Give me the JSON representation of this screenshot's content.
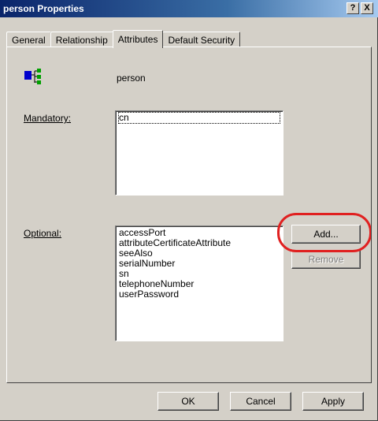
{
  "window": {
    "title": "person Properties",
    "help_button": "?",
    "close_button": "X"
  },
  "tabs": [
    {
      "label": "General",
      "active": false
    },
    {
      "label": "Relationship",
      "active": false
    },
    {
      "label": "Attributes",
      "active": true
    },
    {
      "label": "Default Security",
      "active": false
    }
  ],
  "object": {
    "icon": "schema-class-icon",
    "name": "person"
  },
  "mandatory": {
    "label": "Mandatory:",
    "items": [
      "cn"
    ]
  },
  "optional": {
    "label": "Optional:",
    "items": [
      "accessPort",
      "attributeCertificateAttribute",
      "seeAlso",
      "serialNumber",
      "sn",
      "telephoneNumber",
      "userPassword"
    ]
  },
  "buttons": {
    "add": "Add...",
    "remove": "Remove",
    "ok": "OK",
    "cancel": "Cancel",
    "apply": "Apply"
  },
  "colors": {
    "highlight_ring": "#e02020",
    "titlebar": "#0a246a"
  }
}
